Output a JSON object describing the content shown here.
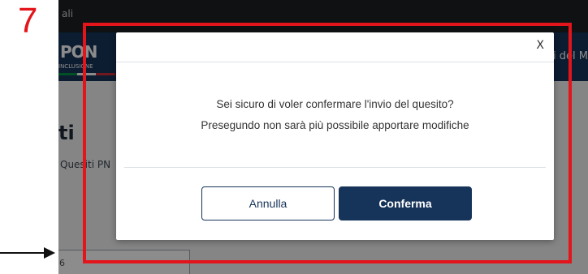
{
  "background": {
    "topbar_text": "ali",
    "logo_text": "PON",
    "logo_subtext": "INCLUSIONE",
    "header_right_text": "li del M",
    "page_title": "ti",
    "breadcrumb": "Quesiti PN",
    "field_value": "6"
  },
  "dialog": {
    "close_label": "X",
    "message_line1": "Sei sicuro di voler confermare l'invio del quesito?",
    "message_line2": "Presegundo non sarà più possibile apportare modifiche",
    "cancel_label": "Annulla",
    "confirm_label": "Conferma"
  },
  "annotation": {
    "step_number": "7",
    "color": "#e3141a"
  },
  "colors": {
    "primary": "#16345a",
    "accent_red": "#e3141a"
  }
}
